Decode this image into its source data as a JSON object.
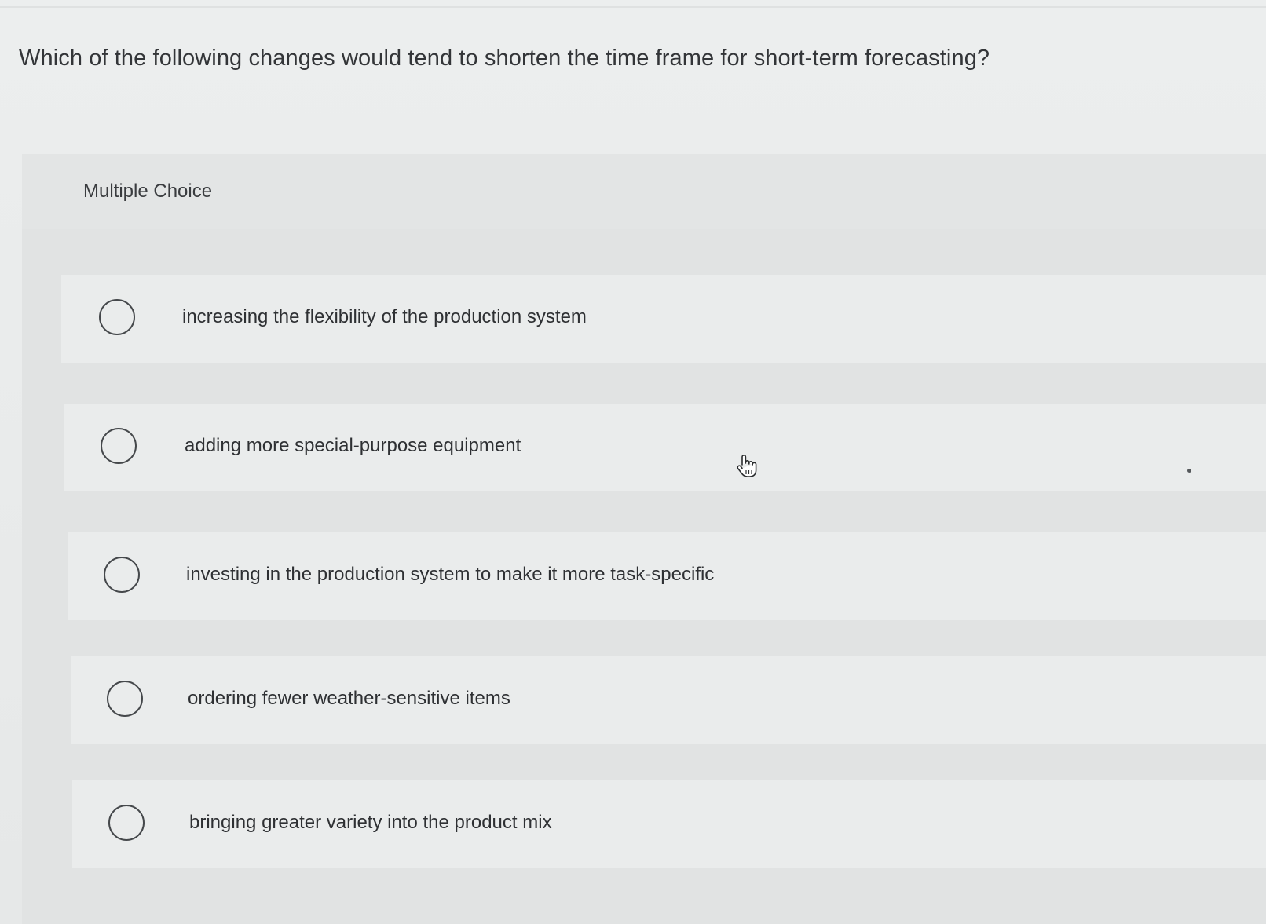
{
  "question": {
    "text": "Which of the following changes would tend to shorten the time frame for short-term forecasting?"
  },
  "panel": {
    "title": "Multiple Choice"
  },
  "options": [
    {
      "label": "increasing the flexibility of the production system",
      "selected": false
    },
    {
      "label": "adding more special-purpose equipment",
      "selected": false
    },
    {
      "label": "investing in the production system to make it more task-specific",
      "selected": false
    },
    {
      "label": "ordering fewer weather-sensitive items",
      "selected": false
    },
    {
      "label": "bringing greater variety into the product mix",
      "selected": false
    }
  ],
  "icons": {
    "radio": "radio-unchecked-icon",
    "cursor": "hand-pointer-cursor-icon"
  },
  "colors": {
    "background": "#e9ebeb",
    "panel": "#e1e3e3",
    "option_row": "#eaecec",
    "text": "#2e3033",
    "radio_border": "#45484b"
  }
}
